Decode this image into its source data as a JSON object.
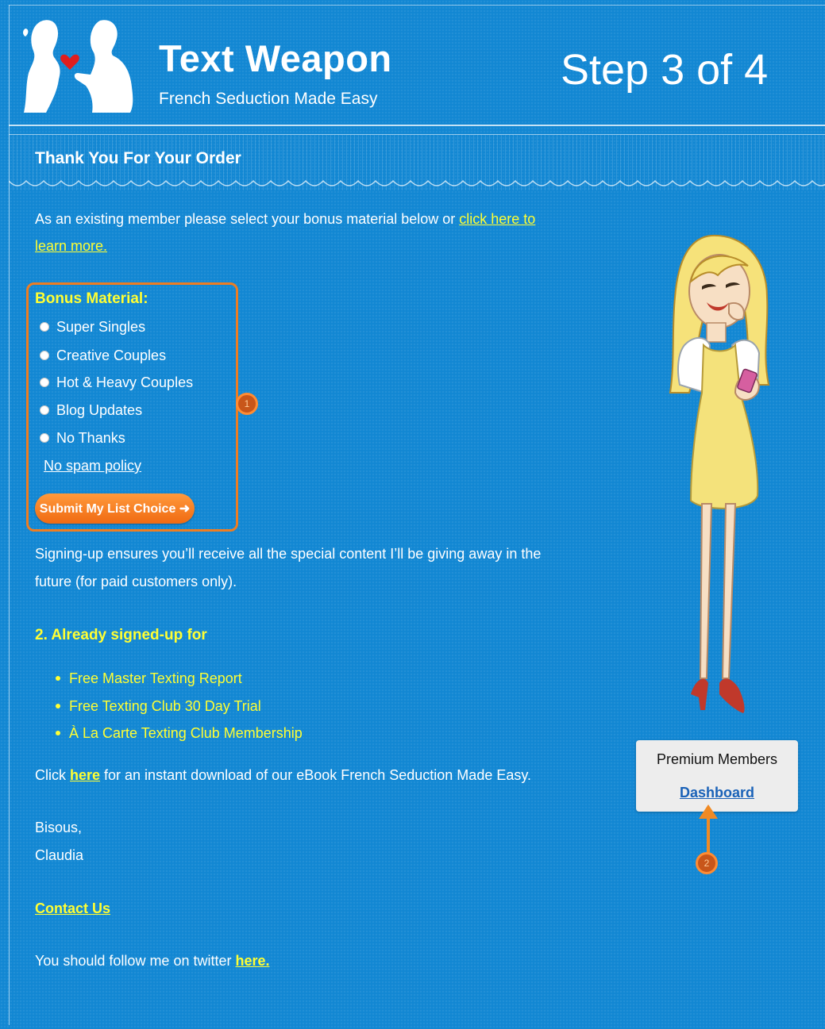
{
  "header": {
    "brand_title": "Text Weapon",
    "brand_tagline": "French Seduction Made Easy",
    "step_text": "Step 3 of 4"
  },
  "banner": {
    "title": "Thank You For Your Order"
  },
  "intro": {
    "text": "As an existing member please select your bonus material below or ",
    "link_line1": "click here to",
    "link_line2": "learn more."
  },
  "bonus": {
    "title": "Bonus Material:",
    "options": [
      "Super Singles",
      "Creative Couples",
      "Hot & Heavy Couples",
      "Blog Updates",
      "No Thanks"
    ],
    "spam_link": "No spam policy",
    "submit_label": "Submit My List Choice ➜",
    "callout_number": "1"
  },
  "signup": {
    "line1": "Signing-up ensures you’ll receive all the special content I’ll be giving away in the",
    "line2": "future (for paid customers only)."
  },
  "already": {
    "title": "2. Already signed-up for",
    "items": [
      "Free Master Texting Report",
      "Free Texting Club 30 Day Trial",
      "À La Carte Texting Club Membership"
    ]
  },
  "download": {
    "prefix": "Click ",
    "link": "here",
    "suffix": " for an instant download of our eBook French Seduction Made Easy."
  },
  "signoff": {
    "line1": "Bisous,",
    "line2": "Claudia"
  },
  "contact_link": "Contact Us",
  "twitter": {
    "prefix": "You should follow me on twitter ",
    "link": "here."
  },
  "premium": {
    "title": "Premium Members",
    "link": "Dashboard",
    "callout_number": "2"
  },
  "colors": {
    "background": "#1287d3",
    "accent_yellow": "#ffff33",
    "callout_orange": "#ee7d22",
    "link_blue": "#1a62b8"
  }
}
